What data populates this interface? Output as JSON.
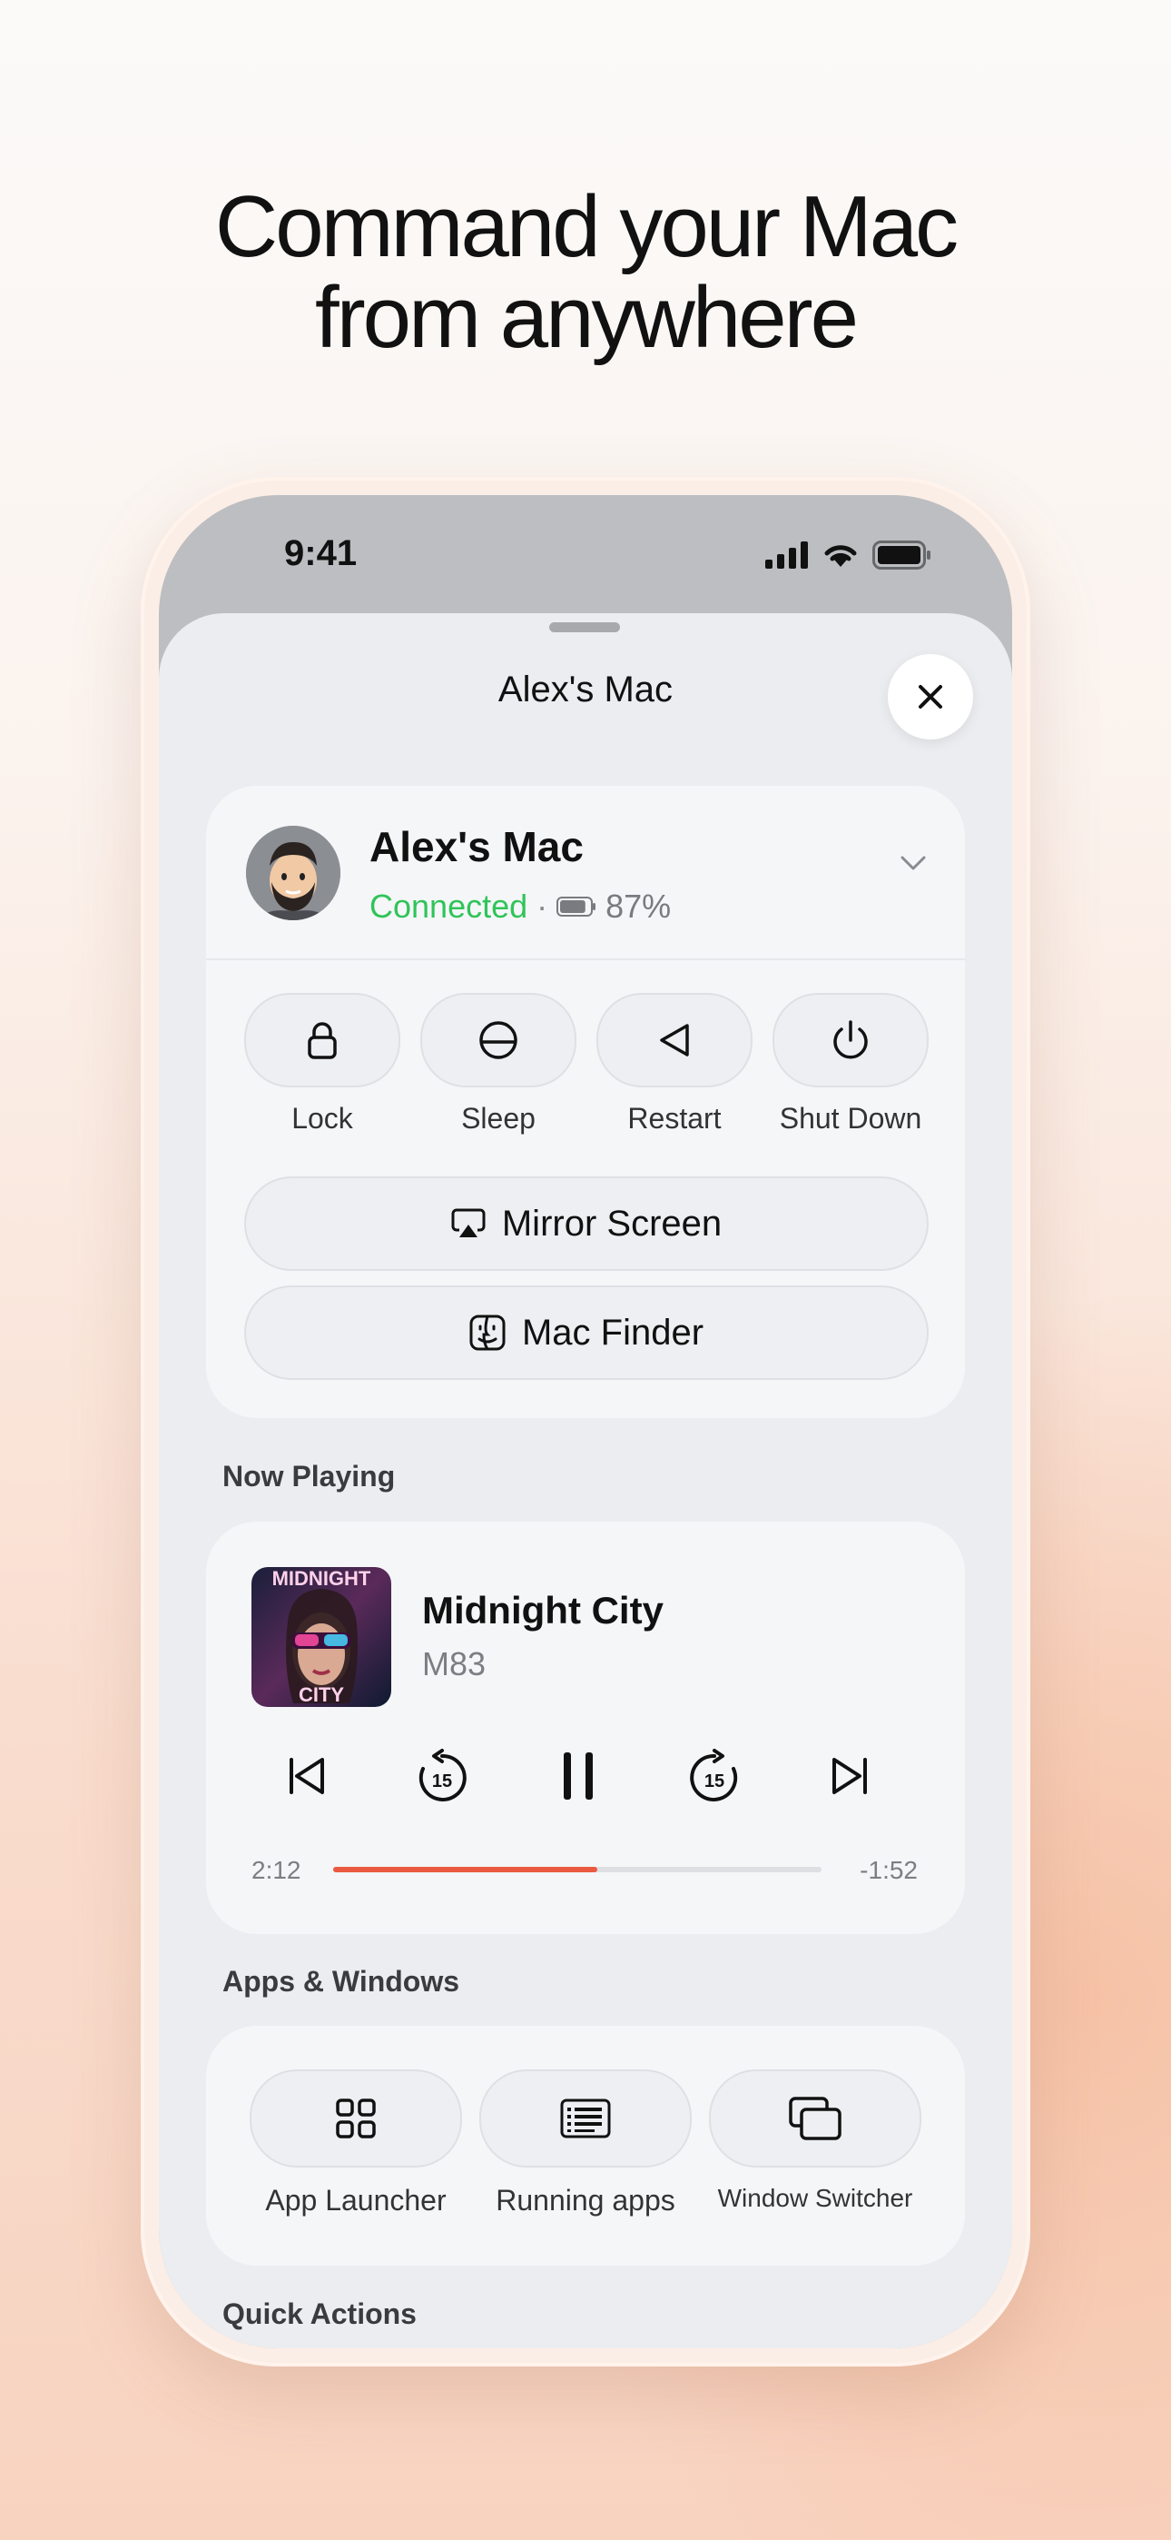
{
  "headline": {
    "line1": "Command your Mac",
    "line2": "from anywhere"
  },
  "status_bar": {
    "time": "9:41"
  },
  "sheet": {
    "title": "Alex's Mac"
  },
  "device": {
    "name": "Alex's Mac",
    "status": "Connected",
    "separator": "·",
    "battery": "87%",
    "battery_level": 0.87
  },
  "power_actions": [
    {
      "label": "Lock",
      "icon": "lock-icon"
    },
    {
      "label": "Sleep",
      "icon": "sleep-icon"
    },
    {
      "label": "Restart",
      "icon": "restart-icon"
    },
    {
      "label": "Shut Down",
      "icon": "power-icon"
    }
  ],
  "buttons": {
    "mirror_screen": "Mirror Screen",
    "mac_finder": "Mac Finder"
  },
  "now_playing": {
    "section_label": "Now Playing",
    "title": "Midnight City",
    "artist": "M83",
    "artwork_text_top": "MIDNIGHT",
    "artwork_text_bottom": "CITY",
    "elapsed": "2:12",
    "remaining": "-1:52",
    "progress": 0.54,
    "skip_seconds": "15"
  },
  "apps": {
    "section_label": "Apps & Windows",
    "items": [
      {
        "label": "App Launcher",
        "icon": "grid-icon"
      },
      {
        "label": "Running apps",
        "icon": "list-window-icon"
      },
      {
        "label": "Window Switcher",
        "icon": "windows-stack-icon"
      }
    ]
  },
  "quick_actions": {
    "section_label": "Quick Actions"
  },
  "colors": {
    "accent_progress": "#ea5a40",
    "connected": "#30c459"
  }
}
